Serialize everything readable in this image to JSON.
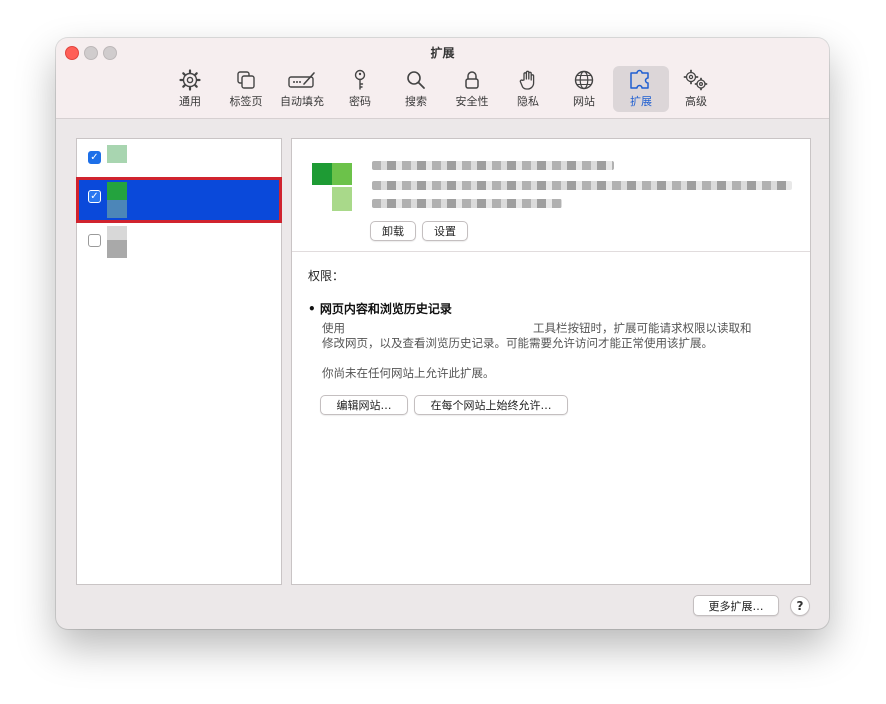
{
  "window": {
    "title": "扩展"
  },
  "toolbar": {
    "items": [
      {
        "label": "通用",
        "icon": "gear-icon"
      },
      {
        "label": "标签页",
        "icon": "tabs-icon"
      },
      {
        "label": "自动填充",
        "icon": "autofill-icon"
      },
      {
        "label": "密码",
        "icon": "key-icon"
      },
      {
        "label": "搜索",
        "icon": "search-icon"
      },
      {
        "label": "安全性",
        "icon": "lock-icon"
      },
      {
        "label": "隐私",
        "icon": "hand-icon"
      },
      {
        "label": "网站",
        "icon": "globe-icon"
      },
      {
        "label": "扩展",
        "icon": "puzzle-icon",
        "active": true
      },
      {
        "label": "高级",
        "icon": "gears-icon"
      }
    ],
    "active_color": "#1f5fd1"
  },
  "sidebar": {
    "extensions": [
      {
        "enabled": true,
        "selected": false
      },
      {
        "enabled": true,
        "selected": true
      },
      {
        "enabled": false,
        "selected": false
      }
    ],
    "selection_color": "#0a49da",
    "highlight_border": "#d0232e"
  },
  "detail": {
    "uninstall_label": "卸载",
    "settings_label": "设置",
    "permissions_title": "权限：",
    "perm_heading": "网页内容和浏览历史记录",
    "perm_desc_prefix": "使用",
    "perm_desc_line1_rest": "工具栏按钮时，扩展可能请求权限以读取和",
    "perm_desc_line2": "修改网页，以及查看浏览历史记录。可能需要允许访问才能正常使用该扩展。",
    "not_allowed_text": "你尚未在任何网站上允许此扩展。",
    "edit_sites_label": "编辑网站…",
    "always_allow_label": "在每个网站上始终允许…"
  },
  "footer": {
    "more_extensions_label": "更多扩展…",
    "help_label": "?"
  }
}
